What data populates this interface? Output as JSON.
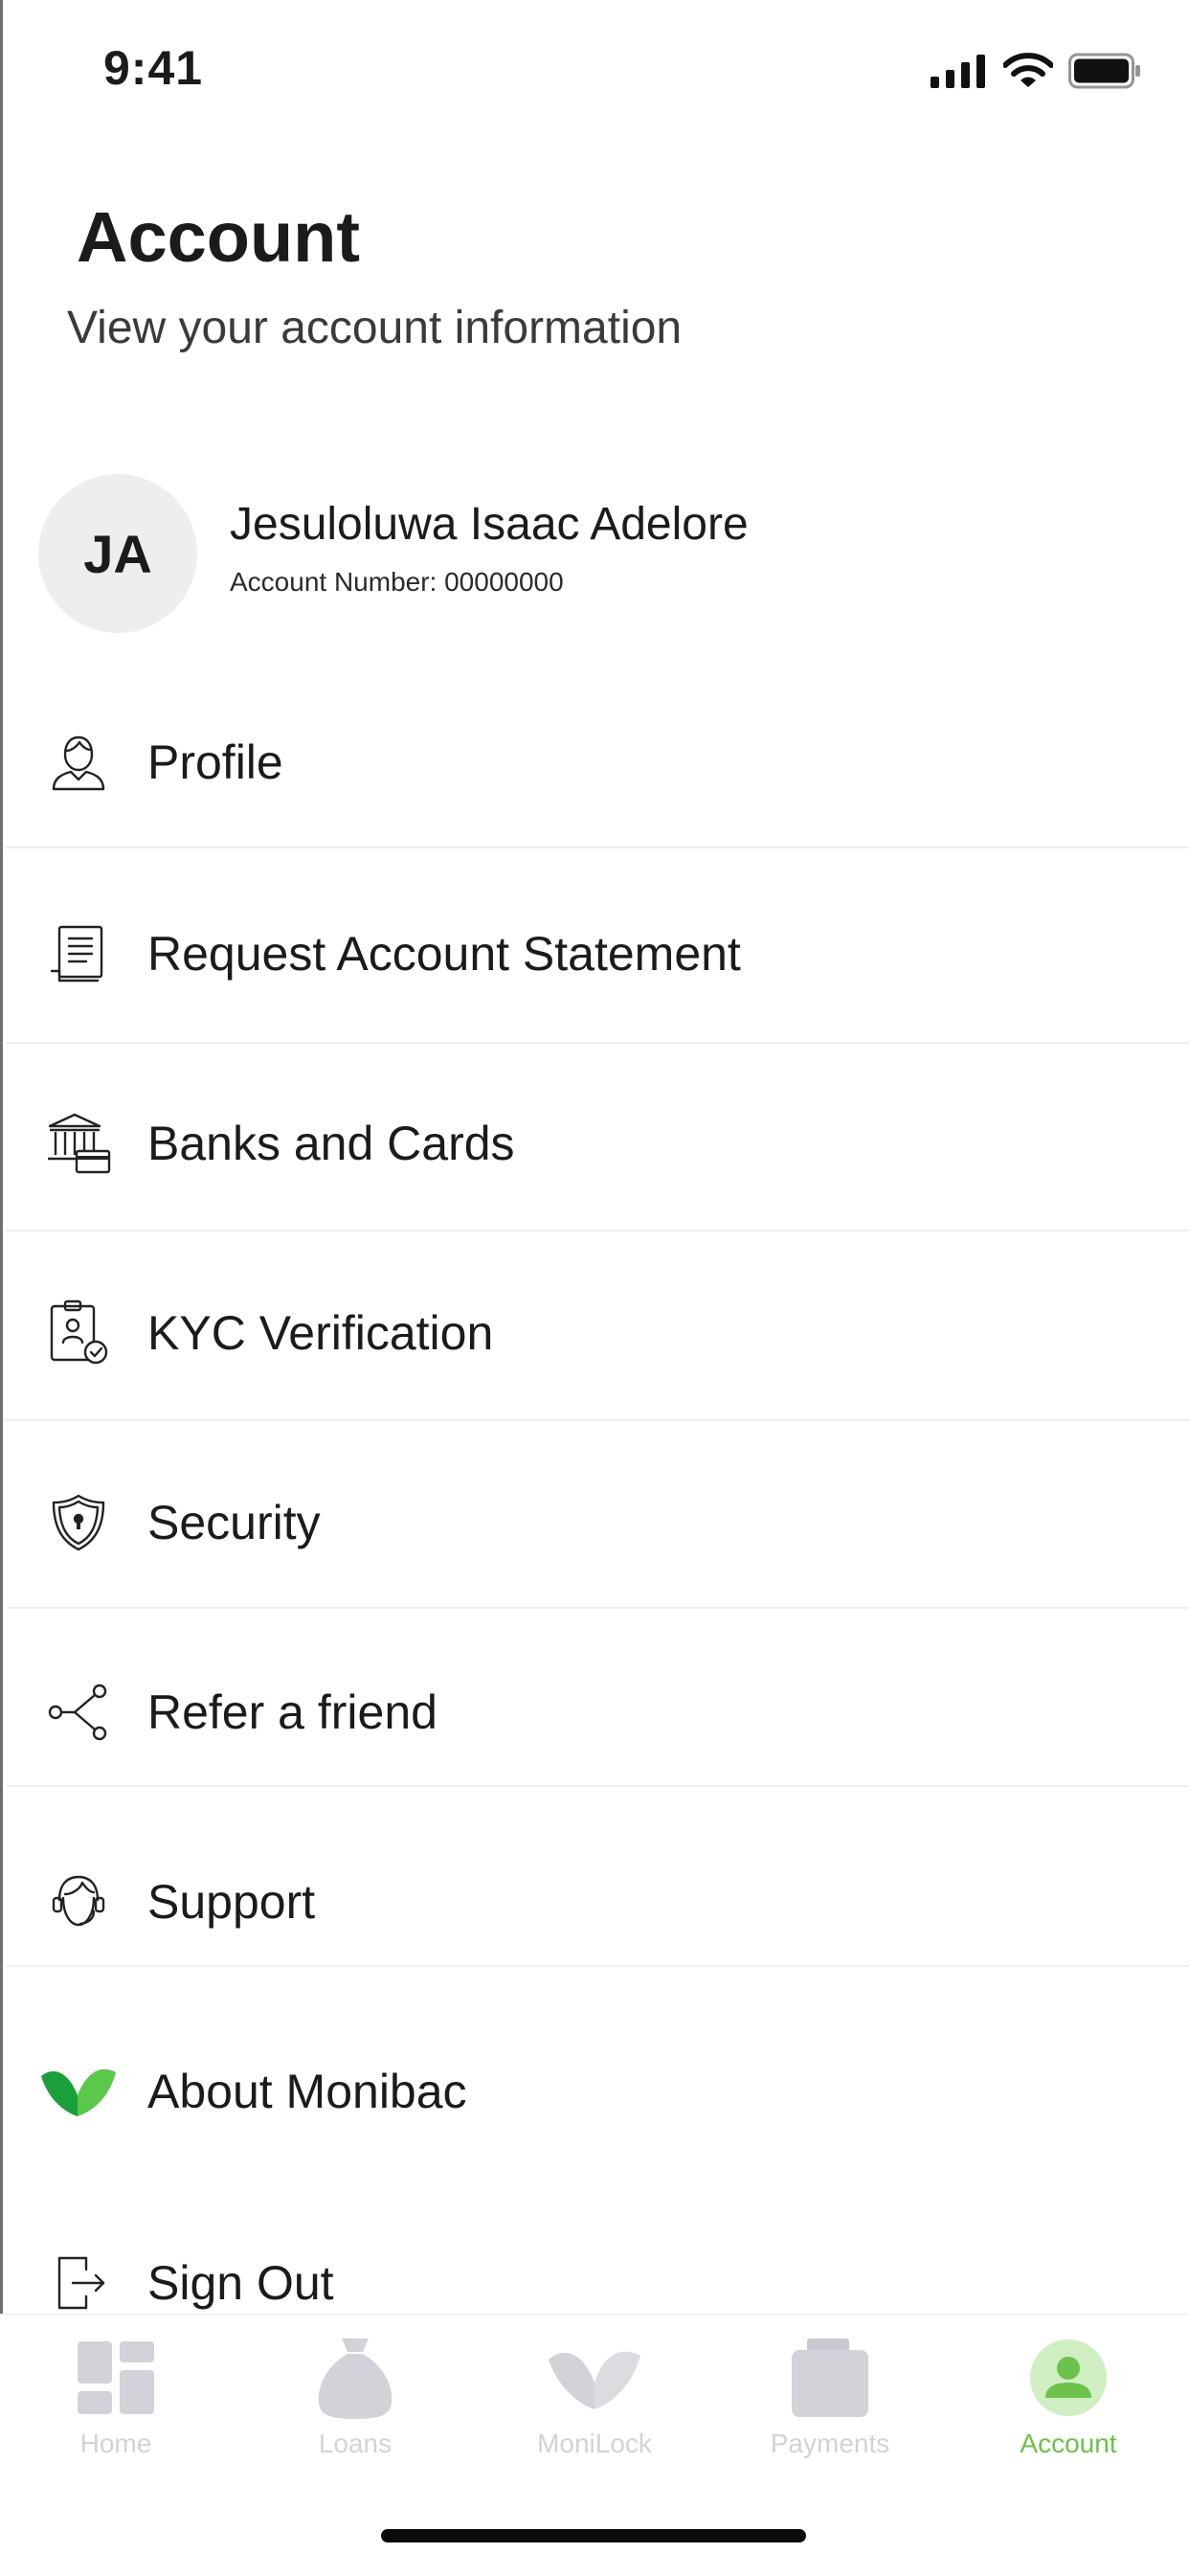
{
  "status_bar": {
    "time": "9:41",
    "icons": [
      "cellular-signal-icon",
      "wifi-icon",
      "battery-icon"
    ]
  },
  "header": {
    "title": "Account",
    "subtitle": "View your account information"
  },
  "profile": {
    "initials": "JA",
    "name": "Jesuloluwa Isaac Adelore",
    "account_number_label": "Account Number: 00000000"
  },
  "menu": {
    "items": [
      {
        "label": "Profile",
        "icon": "user-profile-icon"
      },
      {
        "label": "Request Account Statement",
        "icon": "statement-document-icon"
      },
      {
        "label": "Banks and Cards",
        "icon": "bank-card-icon"
      },
      {
        "label": "KYC Verification",
        "icon": "id-badge-verified-icon"
      },
      {
        "label": "Security",
        "icon": "shield-lock-icon"
      },
      {
        "label": "Refer a friend",
        "icon": "share-icon"
      },
      {
        "label": "Support",
        "icon": "support-agent-icon"
      },
      {
        "label": "About Monibac",
        "icon": "monibac-logo-icon"
      },
      {
        "label": "Sign Out",
        "icon": "sign-out-icon"
      }
    ]
  },
  "tab_bar": {
    "tabs": [
      {
        "label": "Home",
        "icon": "home-dashboard-icon",
        "active": false
      },
      {
        "label": "Loans",
        "icon": "money-bag-icon",
        "active": false
      },
      {
        "label": "MoniLock",
        "icon": "monilock-icon",
        "active": false
      },
      {
        "label": "Payments",
        "icon": "wallet-icon",
        "active": false
      },
      {
        "label": "Account",
        "icon": "account-person-icon",
        "active": true
      }
    ]
  },
  "colors": {
    "accent_green": "#6cc24a",
    "brand_green": "#2eb82e",
    "inactive_tab": "#d2d2d8",
    "text_primary": "#1b1b1b",
    "divider": "#efefef",
    "avatar_bg": "#eeeeee"
  }
}
